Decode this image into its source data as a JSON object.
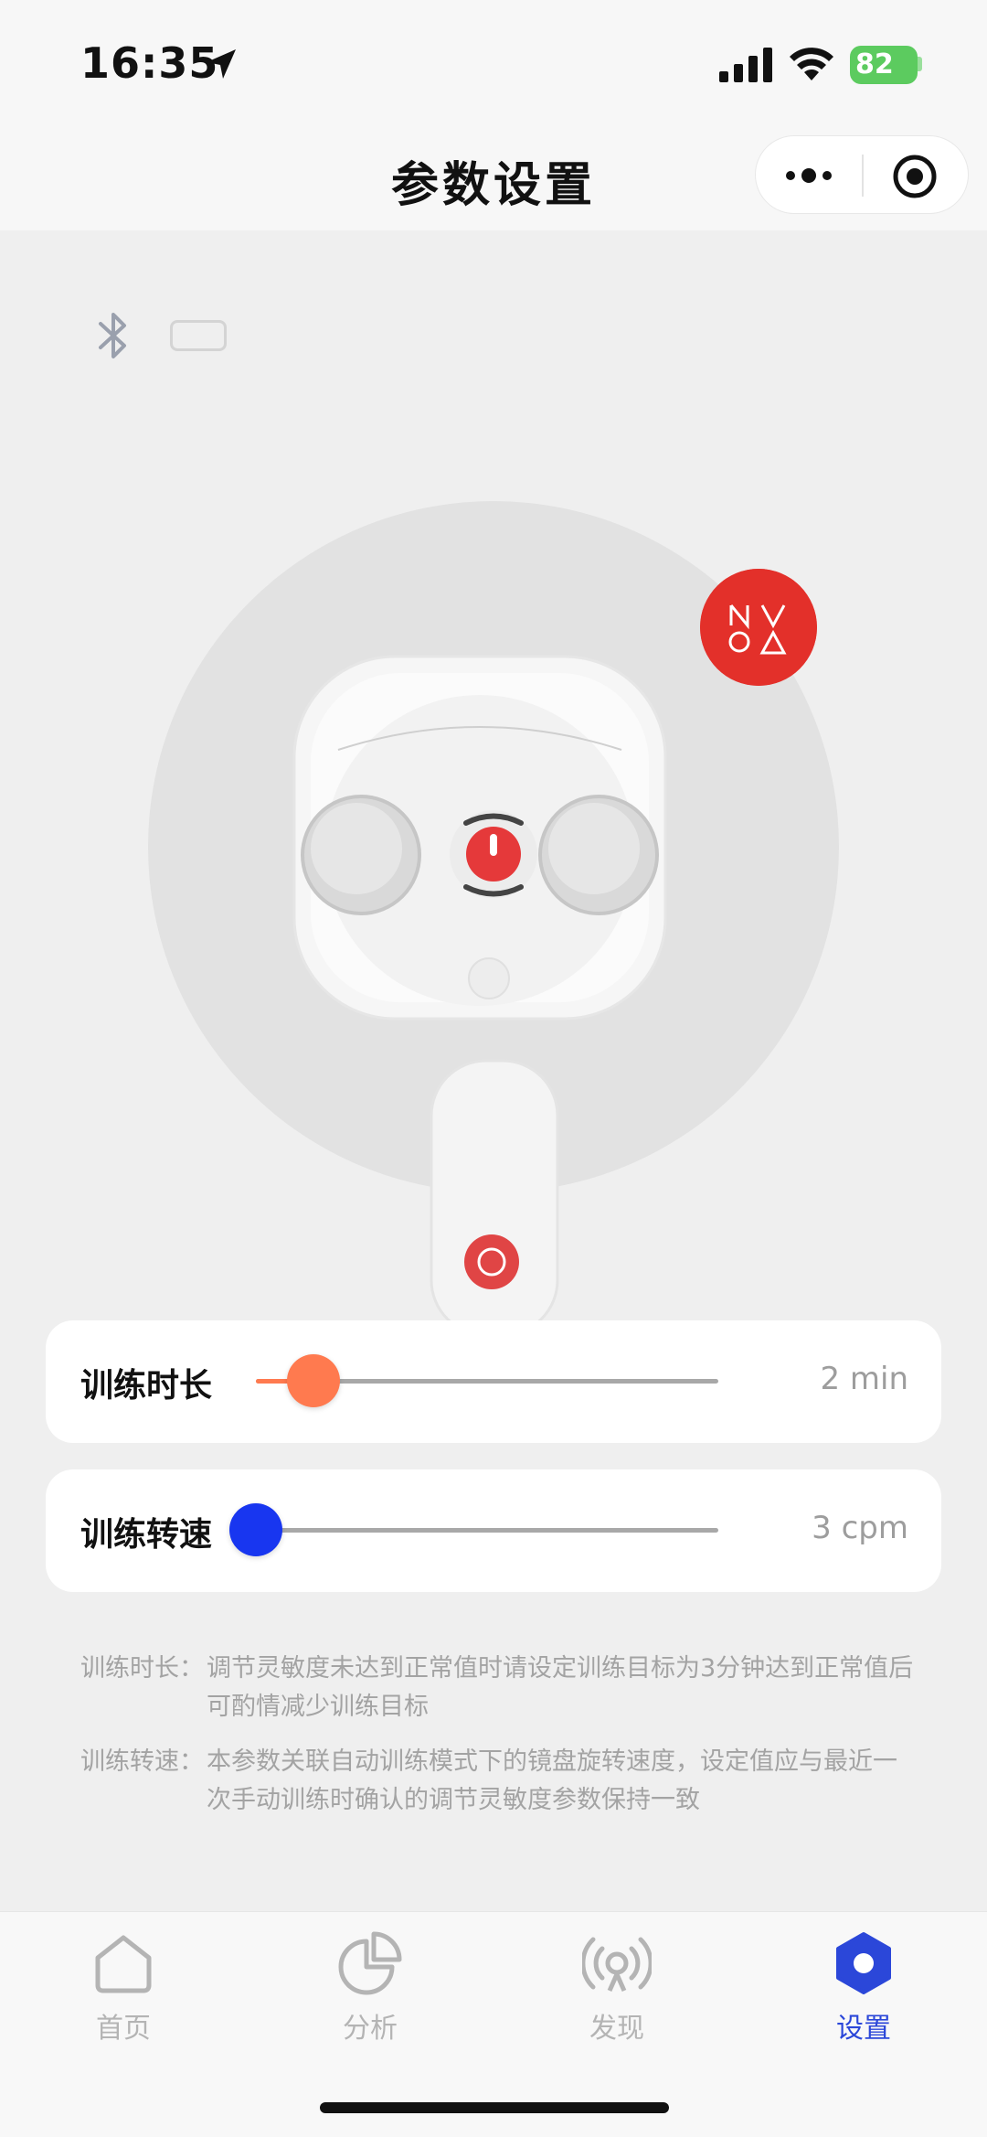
{
  "status_bar": {
    "time": "16:35",
    "battery_level": "82",
    "icons": [
      "location-arrow-icon",
      "cellular-signal-icon",
      "wifi-icon",
      "battery-charging-icon"
    ]
  },
  "header": {
    "title": "参数设置",
    "capsule_icons": [
      "more-dots-icon",
      "close-target-icon"
    ]
  },
  "device": {
    "icons": [
      "bluetooth-icon",
      "device-battery-icon"
    ],
    "badge_icon": "nova-logo-icon"
  },
  "settings": {
    "duration": {
      "label": "训练时长",
      "value": "2 min",
      "slider_fraction": 0.125,
      "color": "#ff7a4f"
    },
    "speed": {
      "label": "训练转速",
      "value": "3 cpm",
      "slider_fraction": 0.0,
      "color": "#1836f0"
    }
  },
  "notes": [
    {
      "key": "训练时长：",
      "text": "调节灵敏度未达到正常值时请设定训练目标为3分钟达到正常值后可酌情减少训练目标"
    },
    {
      "key": "训练转速：",
      "text": "本参数关联自动训练模式下的镜盘旋转速度，设定值应与最近一次手动训练时确认的调节灵敏度参数保持一致"
    }
  ],
  "tabs": [
    {
      "label": "首页",
      "icon": "home-icon",
      "active": false
    },
    {
      "label": "分析",
      "icon": "pie-chart-icon",
      "active": false
    },
    {
      "label": "发现",
      "icon": "broadcast-icon",
      "active": false
    },
    {
      "label": "设置",
      "icon": "settings-hexagon-icon",
      "active": true
    }
  ],
  "colors": {
    "accent": "#2b47d9",
    "inactive": "#b4b4b4",
    "nova_red": "#e3302a"
  }
}
